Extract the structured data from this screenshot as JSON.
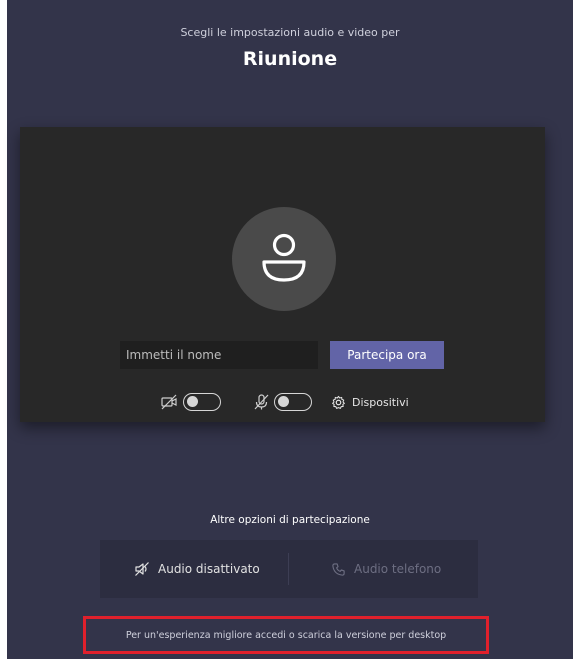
{
  "header": {
    "subtitle": "Scegli le impostazioni audio e video per",
    "title": "Riunione"
  },
  "preview": {
    "name_placeholder": "Immetti il nome",
    "join_label": "Partecipa ora",
    "camera_toggle_on": false,
    "mic_toggle_on": false,
    "devices_label": "Dispositivi"
  },
  "other_options": {
    "label": "Altre opzioni di partecipazione",
    "audio_off_label": "Audio disattivato",
    "phone_audio_label": "Audio telefono"
  },
  "desktop_note": "Per un'esperienza migliore accedi o scarica la versione per desktop",
  "colors": {
    "background": "#33344a",
    "preview_bg": "#282828",
    "accent": "#6264a7",
    "highlight_border": "#e0202c"
  }
}
